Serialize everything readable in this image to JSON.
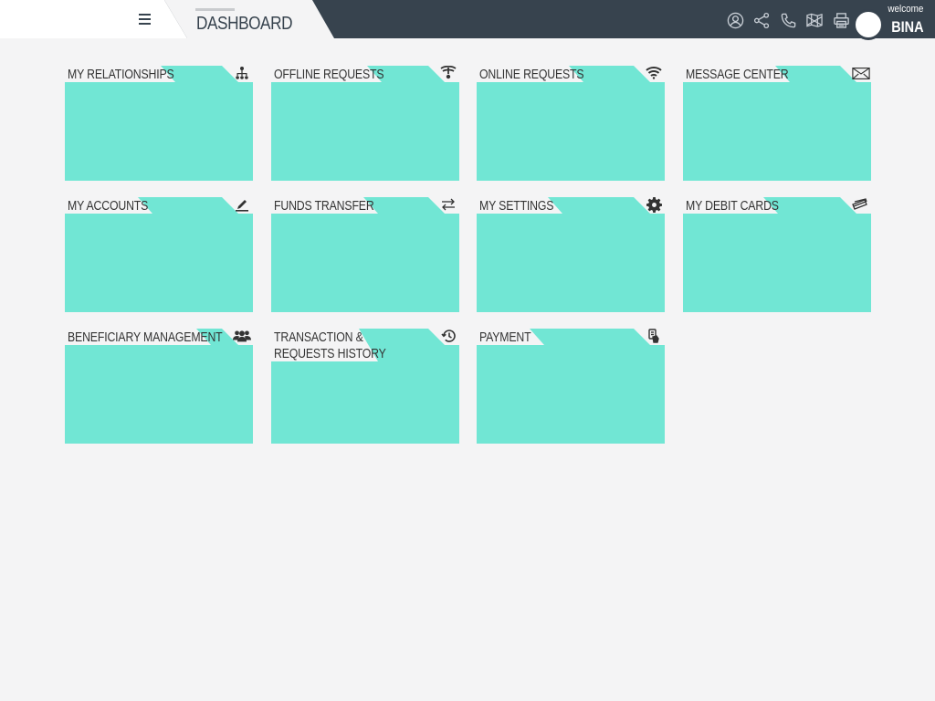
{
  "header": {
    "page_title": "DASHBOARD",
    "welcome": "welcome",
    "username": "BINA",
    "icons": [
      "user-icon",
      "share-icon",
      "phone-icon",
      "map-icon",
      "print-icon"
    ]
  },
  "colors": {
    "header_bg": "#37434e",
    "tile": "#71e6d4",
    "page_bg": "#f4f4f5"
  },
  "tiles": [
    {
      "label": "MY RELATIONSHIPS",
      "icon": "relationships-icon"
    },
    {
      "label": "OFFLINE REQUESTS",
      "icon": "offline-icon"
    },
    {
      "label": "ONLINE REQUESTS",
      "icon": "wifi-icon"
    },
    {
      "label": "MESSAGE CENTER",
      "icon": "envelope-icon"
    },
    {
      "label": "MY ACCOUNTS",
      "icon": "edit-icon"
    },
    {
      "label": "FUNDS TRANSFER",
      "icon": "transfer-icon"
    },
    {
      "label": "MY SETTINGS",
      "icon": "gear-icon"
    },
    {
      "label": "MY DEBIT CARDS",
      "icon": "cards-icon"
    },
    {
      "label": "BENEFICIARY MANAGEMENT",
      "icon": "users-icon"
    },
    {
      "label": "TRANSACTION &",
      "label2": "REQUESTS HISTORY",
      "icon": "history-icon"
    },
    {
      "label": "PAYMENT",
      "icon": "payment-icon"
    }
  ]
}
